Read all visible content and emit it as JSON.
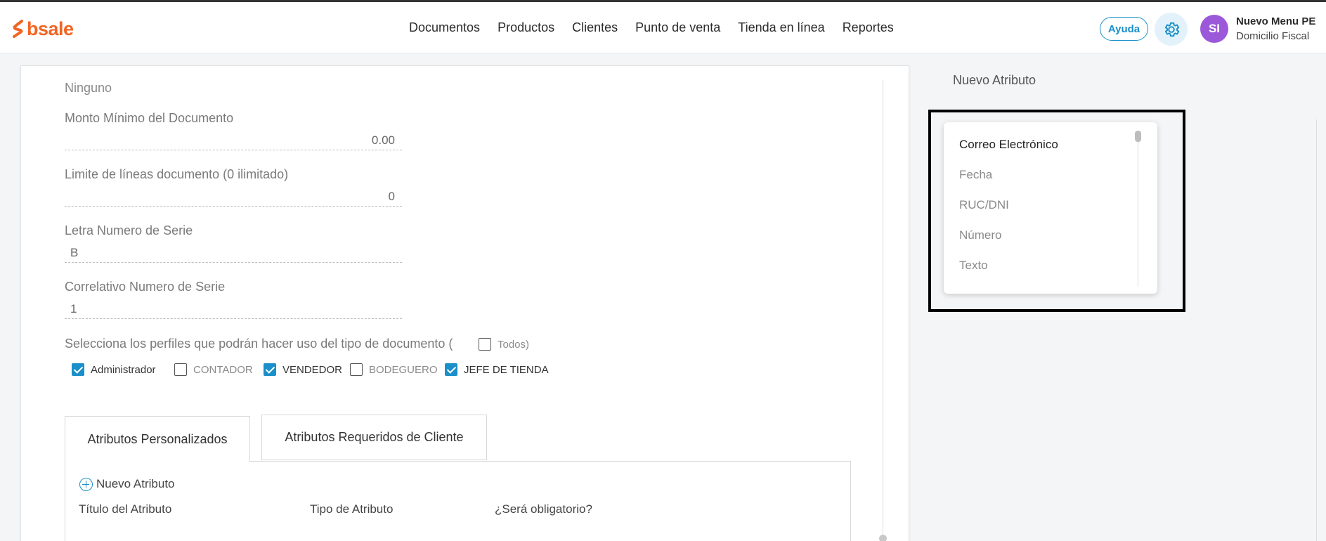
{
  "app": {
    "logo_text": "bsale",
    "nav": [
      "Documentos",
      "Productos",
      "Clientes",
      "Punto de venta",
      "Tienda en línea",
      "Reportes"
    ],
    "help_label": "Ayuda",
    "user": {
      "initials": "SI",
      "name": "Nuevo Menu PE",
      "subtitle": "Domicilio Fiscal"
    },
    "colors": {
      "brand": "#f26522",
      "accent": "#1a8fc9",
      "avatar": "#9b59d9"
    }
  },
  "form": {
    "ninguno": "Ninguno",
    "monto_label": "Monto Mínimo del Documento",
    "monto_value": "0.00",
    "limite_label": "Limite de líneas documento (0 ilimitado)",
    "limite_value": "0",
    "letra_label": "Letra Numero de Serie",
    "letra_value": "B",
    "correlativo_label": "Correlativo Numero de Serie",
    "correlativo_value": "1",
    "perfiles_label": "Selecciona los perfiles que podrán hacer uso del tipo de documento (",
    "todos_label": "Todos)",
    "profiles": [
      {
        "label": "Administrador",
        "checked": true
      },
      {
        "label": "CONTADOR",
        "checked": false
      },
      {
        "label": "VENDEDOR",
        "checked": true
      },
      {
        "label": "BODEGUERO",
        "checked": false
      },
      {
        "label": "JEFE DE TIENDA",
        "checked": true
      }
    ]
  },
  "tabs": {
    "personalizados": "Atributos Personalizados",
    "requeridos": "Atributos Requeridos de Cliente"
  },
  "attributes": {
    "new_label": "Nuevo Atributo",
    "columns": [
      "Título del Atributo",
      "Tipo de Atributo",
      "¿Será obligatorio?"
    ]
  },
  "side": {
    "title": "Nuevo Atributo",
    "options": [
      "Correo Electrónico",
      "Fecha",
      "RUC/DNI",
      "Número",
      "Texto"
    ]
  }
}
